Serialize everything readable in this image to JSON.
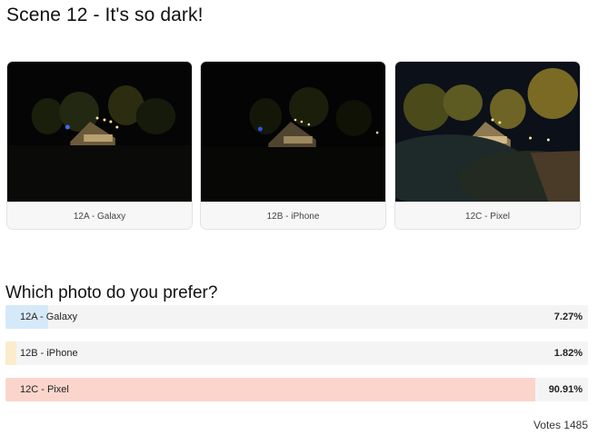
{
  "title": "Scene 12 - It's so dark!",
  "photos": [
    {
      "caption": "12A - Galaxy"
    },
    {
      "caption": "12B - iPhone"
    },
    {
      "caption": "12C - Pixel"
    }
  ],
  "poll": {
    "question": "Which photo do you prefer?",
    "options": [
      {
        "label": "12A - Galaxy",
        "percent_text": "7.27%",
        "percent": 7.27,
        "color": "#d6e9f8"
      },
      {
        "label": "12B - iPhone",
        "percent_text": "1.82%",
        "percent": 1.82,
        "color": "#fbeccc"
      },
      {
        "label": "12C - Pixel",
        "percent_text": "90.91%",
        "percent": 90.91,
        "color": "#fbd5cc"
      }
    ],
    "votes_text": "Votes 1485"
  }
}
